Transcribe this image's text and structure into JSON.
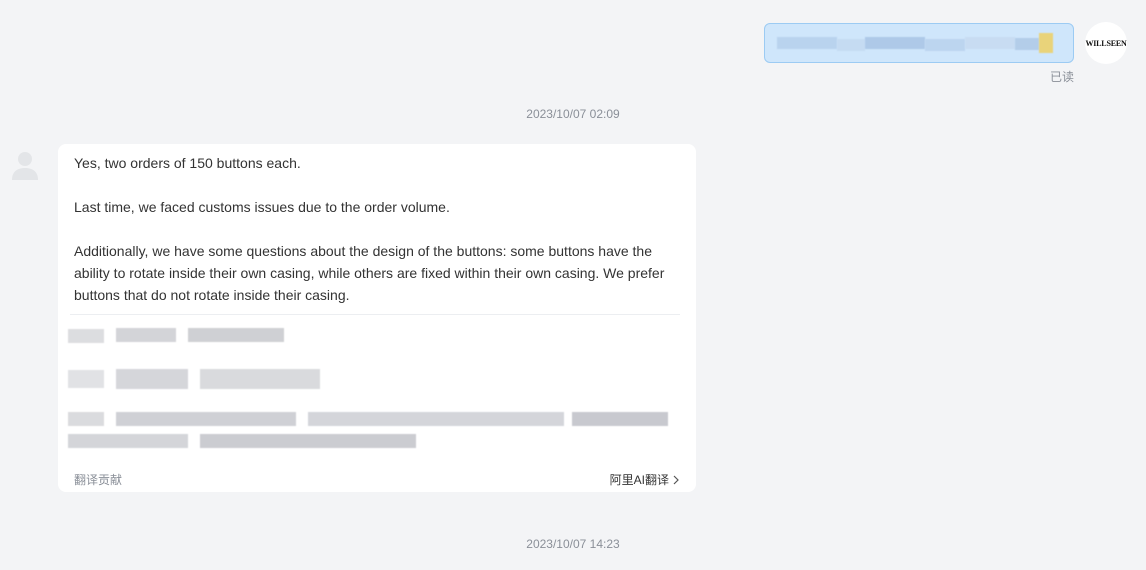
{
  "outgoing": {
    "avatar_text": "WILLSEEN",
    "read_status": "已读"
  },
  "timestamps": [
    "2023/10/07 02:09",
    "2023/10/07 14:23"
  ],
  "incoming": {
    "paragraphs": [
      "Yes, two orders of 150 buttons each.",
      "Last time, we faced customs issues due to the order volume.",
      "Additionally, we have some questions about the design of the buttons: some buttons have the ability to rotate inside their own casing, while others are fixed within their own casing. We prefer buttons that do not rotate inside their casing."
    ],
    "translate_contribute": "翻译贡献",
    "ai_translate": "阿里AI翻译"
  },
  "icons": {
    "default_avatar": "user-silhouette-icon",
    "chevron": "chevron-right-icon"
  },
  "colors": {
    "background": "#f3f4f6",
    "outgoing_bubble": "#cfe6fb",
    "outgoing_border": "#9ccbf3",
    "muted_text": "#8a8f98"
  }
}
